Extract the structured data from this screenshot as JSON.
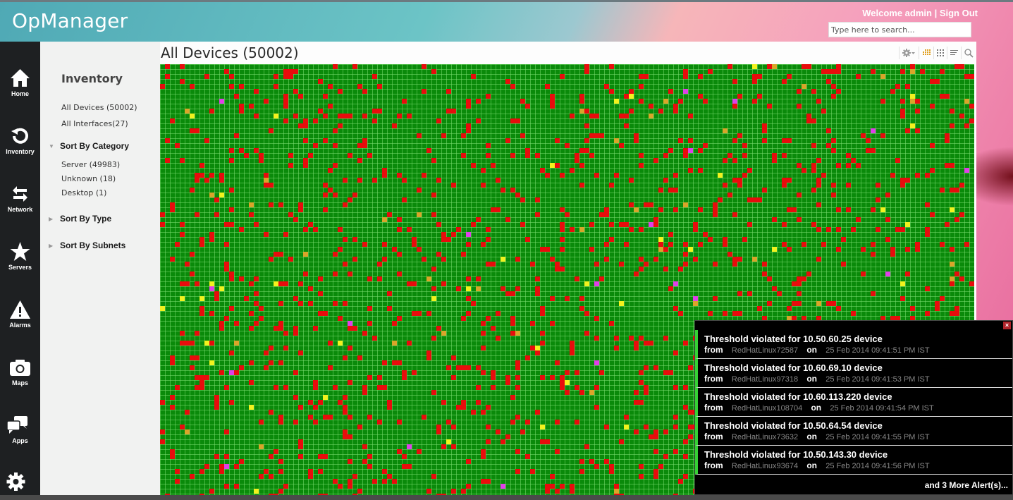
{
  "app": {
    "logo": "OpManager",
    "welcome": "Welcome admin",
    "separator": " | ",
    "sign_out": "Sign Out",
    "search_placeholder": "Type here to search..."
  },
  "nav": [
    {
      "label": "Home",
      "icon": "home-icon"
    },
    {
      "label": "Inventory",
      "icon": "refresh-icon"
    },
    {
      "label": "Network",
      "icon": "swap-arrows-icon"
    },
    {
      "label": "Servers",
      "icon": "star-icon"
    },
    {
      "label": "Alarms",
      "icon": "warning-icon"
    },
    {
      "label": "Maps",
      "icon": "camera-icon"
    },
    {
      "label": "Apps",
      "icon": "chat-bubbles-icon"
    },
    {
      "label": "",
      "icon": "gear-icon"
    }
  ],
  "sidebar": {
    "title": "Inventory",
    "links": [
      "All Devices (50002)",
      "All Interfaces(27)"
    ],
    "sections": [
      {
        "label": "Sort By Category",
        "expanded": true,
        "items": [
          "Server (49983)",
          "Unknown (18)",
          "Desktop (1)"
        ]
      },
      {
        "label": "Sort By Type",
        "expanded": false,
        "items": []
      },
      {
        "label": "Sort By Subnets",
        "expanded": false,
        "items": []
      }
    ]
  },
  "main": {
    "title": "All Devices (50002)",
    "toolbar": [
      "settings-dropdown",
      "heatmap-view",
      "grid-view",
      "list-view",
      "search"
    ],
    "heatmap": {
      "total_devices": 50002,
      "status_colors": {
        "clear": "#0a8a0a",
        "critical": "#e80c0c",
        "trouble": "#f2f21e",
        "attention": "#d9a52a",
        "service_down": "#e040e8"
      },
      "status_share": {
        "critical": 0.085,
        "trouble": 0.004,
        "attention": 0.003,
        "service_down": 0.001
      }
    }
  },
  "alerts": {
    "items": [
      {
        "title": "Threshold violated for 10.50.60.25 device",
        "from_label": "from",
        "source": "RedHatLinux72587",
        "on_label": "on",
        "time": "25 Feb 2014 09:41:51 PM IST"
      },
      {
        "title": "Threshold violated for 10.60.69.10 device",
        "from_label": "from",
        "source": "RedHatLinux97318",
        "on_label": "on",
        "time": "25 Feb 2014 09:41:53 PM IST"
      },
      {
        "title": "Threshold violated for 10.60.113.220 device",
        "from_label": "from",
        "source": "RedHatLinux108704",
        "on_label": "on",
        "time": "25 Feb 2014 09:41:54 PM IST"
      },
      {
        "title": "Threshold violated for 10.50.64.54 device",
        "from_label": "from",
        "source": "RedHatLinux73632",
        "on_label": "on",
        "time": "25 Feb 2014 09:41:55 PM IST"
      },
      {
        "title": "Threshold violated for 10.50.143.30 device",
        "from_label": "from",
        "source": "RedHatLinux93674",
        "on_label": "on",
        "time": "25 Feb 2014 09:41:56 PM IST"
      }
    ],
    "more": "and 3 More Alert(s)...",
    "close": "×"
  }
}
